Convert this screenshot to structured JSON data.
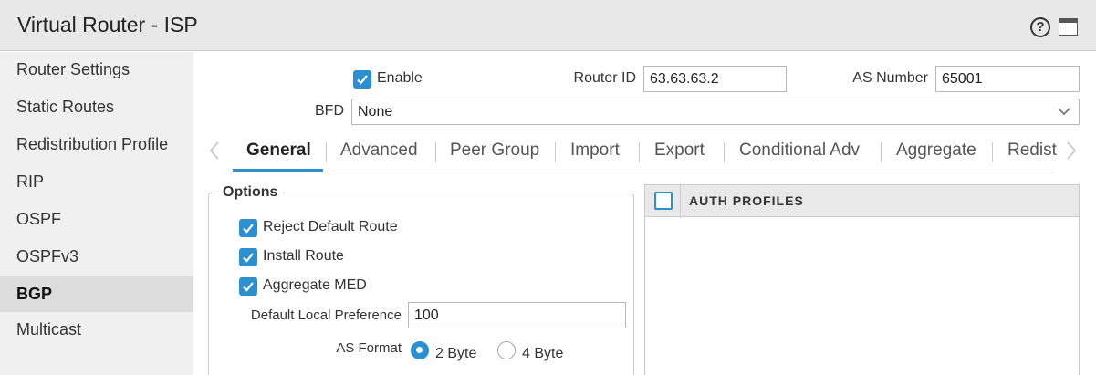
{
  "window": {
    "title": "Virtual Router - ISP"
  },
  "sidebar": {
    "items": [
      {
        "label": "Router Settings"
      },
      {
        "label": "Static Routes"
      },
      {
        "label": "Redistribution Profile"
      },
      {
        "label": "RIP"
      },
      {
        "label": "OSPF"
      },
      {
        "label": "OSPFv3"
      },
      {
        "label": "BGP",
        "active": true
      },
      {
        "label": "Multicast"
      }
    ]
  },
  "bgp": {
    "enable_label": "Enable",
    "enable_checked": true,
    "router_id_label": "Router ID",
    "router_id": "63.63.63.2",
    "as_number_label": "AS Number",
    "as_number": "65001",
    "bfd_label": "BFD",
    "bfd_value": "None"
  },
  "tabs": [
    {
      "label": "General",
      "active": true
    },
    {
      "label": "Advanced"
    },
    {
      "label": "Peer Group"
    },
    {
      "label": "Import"
    },
    {
      "label": "Export"
    },
    {
      "label": "Conditional Adv"
    },
    {
      "label": "Aggregate"
    },
    {
      "label": "Redist"
    }
  ],
  "options": {
    "legend": "Options",
    "reject_default_route": {
      "label": "Reject Default Route",
      "checked": true
    },
    "install_route": {
      "label": "Install Route",
      "checked": true
    },
    "aggregate_med": {
      "label": "Aggregate MED",
      "checked": true
    },
    "default_local_pref_label": "Default Local Preference",
    "default_local_pref": "100",
    "as_format_label": "AS Format",
    "as_format_options": [
      "2 Byte",
      "4 Byte"
    ],
    "as_format_selected": "2 Byte"
  },
  "auth_profiles": {
    "column": "AUTH PROFILES",
    "rows": []
  },
  "colors": {
    "accent": "#2b8fd0",
    "titlebar": "#e8e8e8",
    "sidebar": "#f0f0f0"
  }
}
